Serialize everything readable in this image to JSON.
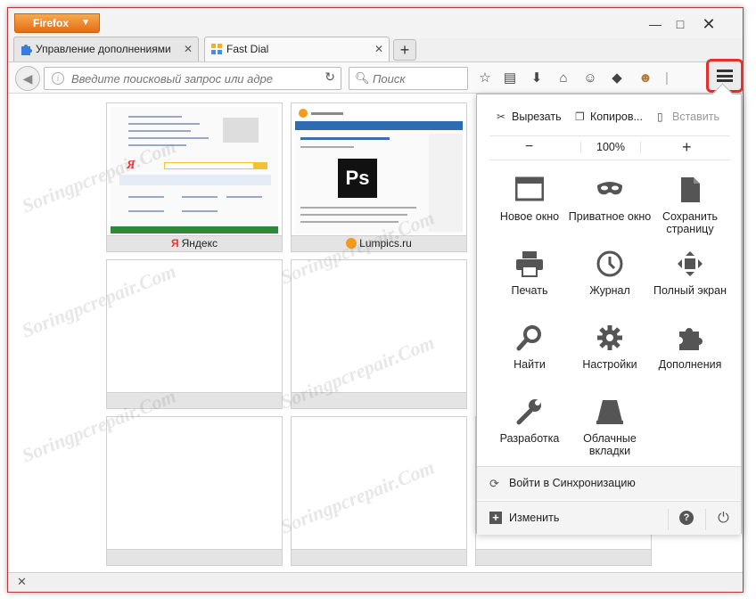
{
  "browser": {
    "app_button_label": "Firefox",
    "window_controls": {
      "minimize": "—",
      "maximize": "□",
      "close": "✕"
    }
  },
  "tabs": [
    {
      "label": "Управление дополнениями",
      "icon": "puzzle-icon",
      "active": false
    },
    {
      "label": "Fast Dial",
      "icon": "fast-dial-icon",
      "active": true
    }
  ],
  "navbar": {
    "url_placeholder": "Введите поисковый запрос или адре",
    "search_placeholder": "Поиск"
  },
  "speed_dial": {
    "tiles": [
      {
        "caption": "Яндекс",
        "favicon": "Я"
      },
      {
        "caption": "Lumpics.ru",
        "favicon": ""
      },
      {
        "caption": ""
      },
      {
        "caption": ""
      },
      {
        "caption": ""
      },
      {
        "caption": ""
      },
      {
        "caption": ""
      },
      {
        "caption": ""
      }
    ]
  },
  "menu_panel": {
    "edit": {
      "cut": "Вырезать",
      "copy": "Копиров...",
      "paste": "Вставить"
    },
    "zoom": {
      "minus": "−",
      "value": "100%",
      "plus": "+"
    },
    "items": [
      {
        "label": "Новое окно",
        "icon": "new-window-icon"
      },
      {
        "label": "Приватное окно",
        "icon": "private-mask-icon"
      },
      {
        "label": "Сохранить страницу",
        "icon": "save-page-icon"
      },
      {
        "label": "Печать",
        "icon": "printer-icon"
      },
      {
        "label": "Журнал",
        "icon": "history-clock-icon"
      },
      {
        "label": "Полный экран",
        "icon": "fullscreen-icon"
      },
      {
        "label": "Найти",
        "icon": "find-magnifier-icon"
      },
      {
        "label": "Настройки",
        "icon": "settings-gear-icon"
      },
      {
        "label": "Дополнения",
        "icon": "addons-puzzle-icon"
      },
      {
        "label": "Разработка",
        "icon": "developer-wrench-icon"
      },
      {
        "label": "Облачные вкладки",
        "icon": "synced-tabs-icon"
      }
    ],
    "sync_label": "Войти в Синхронизацию",
    "customize_label": "Изменить",
    "help": "?"
  },
  "watermark": "Soringpcrepair.Com"
}
